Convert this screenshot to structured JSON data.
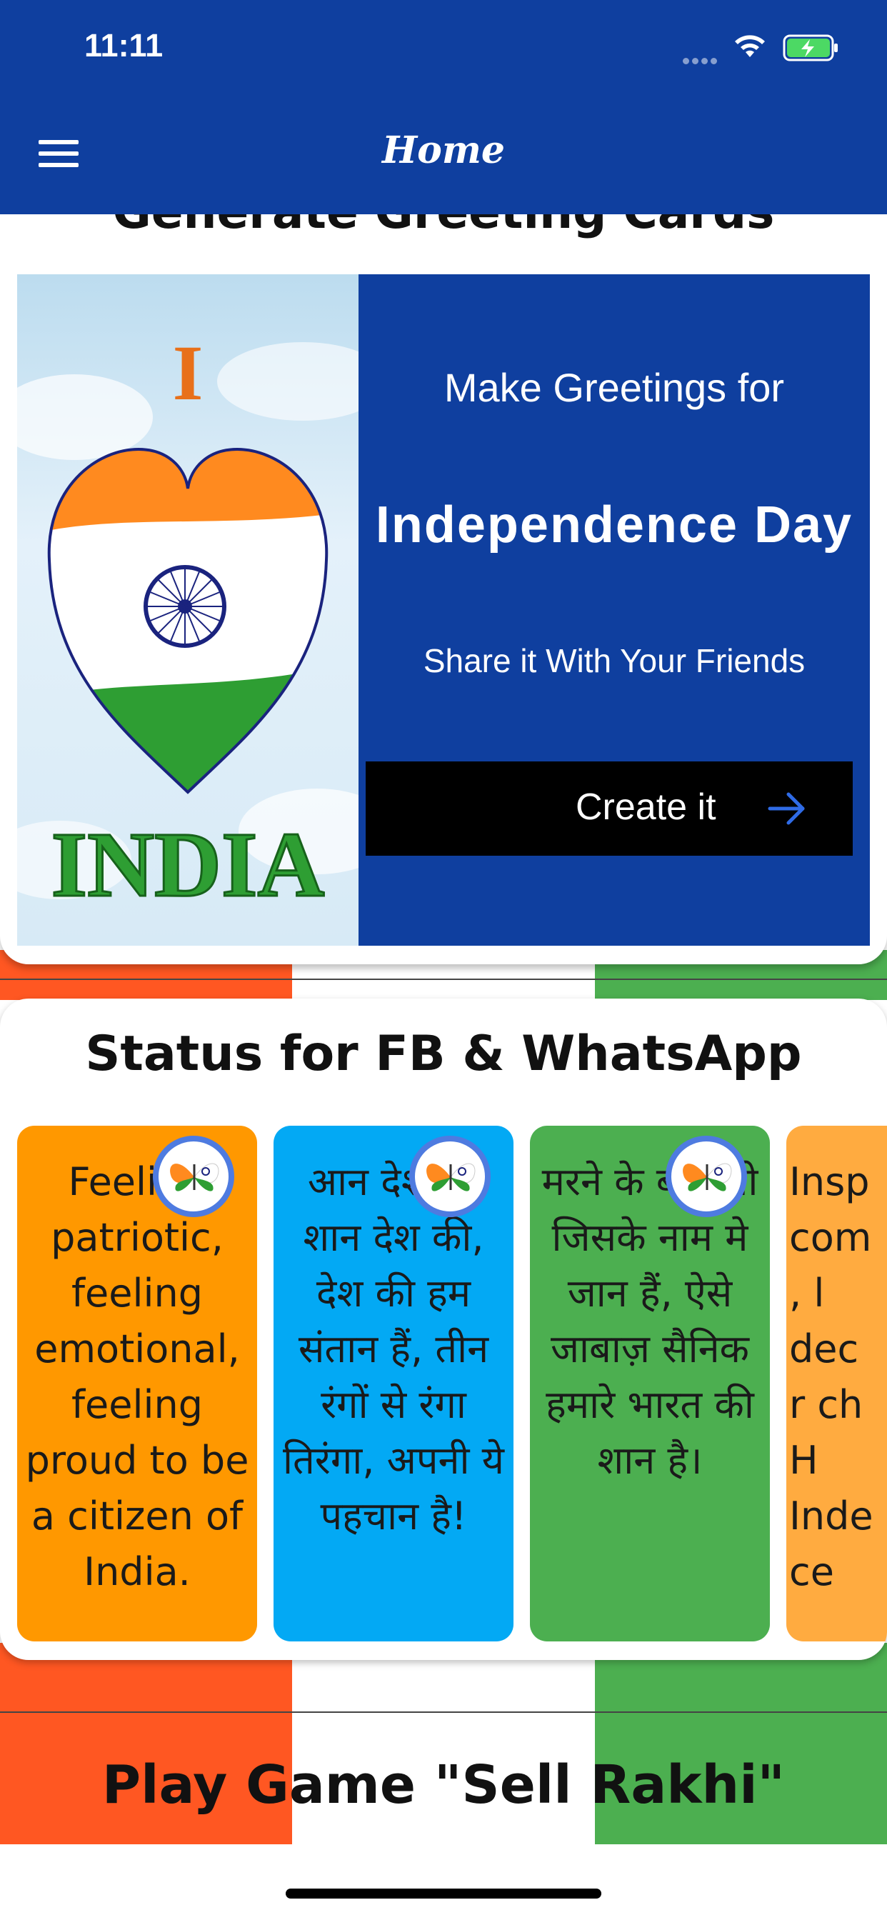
{
  "status_bar": {
    "time": "11:11"
  },
  "header": {
    "title": "Home",
    "menu_icon": "hamburger-menu-icon"
  },
  "greeting": {
    "heading": "Generate Greeting Cards",
    "image_top_text": "I",
    "image_bottom_text": "INDIA",
    "line1": "Make Greetings for",
    "line2": "Independence Day",
    "line3": "Share it With Your Friends",
    "button_label": "Create it",
    "button_icon": "arrow-right-icon"
  },
  "status": {
    "heading": "Status for FB & WhatsApp",
    "cards": [
      {
        "text": "Feeling patriotic, feeling emotional, feeling proud to be a citizen of India.",
        "color": "#FF9800"
      },
      {
        "text": "आन देश की शान देश की, देश की हम संतान हैं, तीन रंगों से रंगा तिरंगा, अपनी ये पहचान है!",
        "color": "#03A9F4"
      },
      {
        "text": "मरने के बाद भी जिसके नाम मे जान हैं, ऐसे जाबाज़ सैनिक हमारे भारत की शान है।",
        "color": "#4CAF50"
      },
      {
        "text": "Insp com , l dec r ch H Inde ce",
        "color": "#FFAB40"
      }
    ]
  },
  "game": {
    "heading": "Play Game \"Sell Rakhi\""
  },
  "colors": {
    "primary": "#0F3F9F",
    "saffron": "#FF5722",
    "green": "#4CAF50",
    "button": "#000000"
  }
}
